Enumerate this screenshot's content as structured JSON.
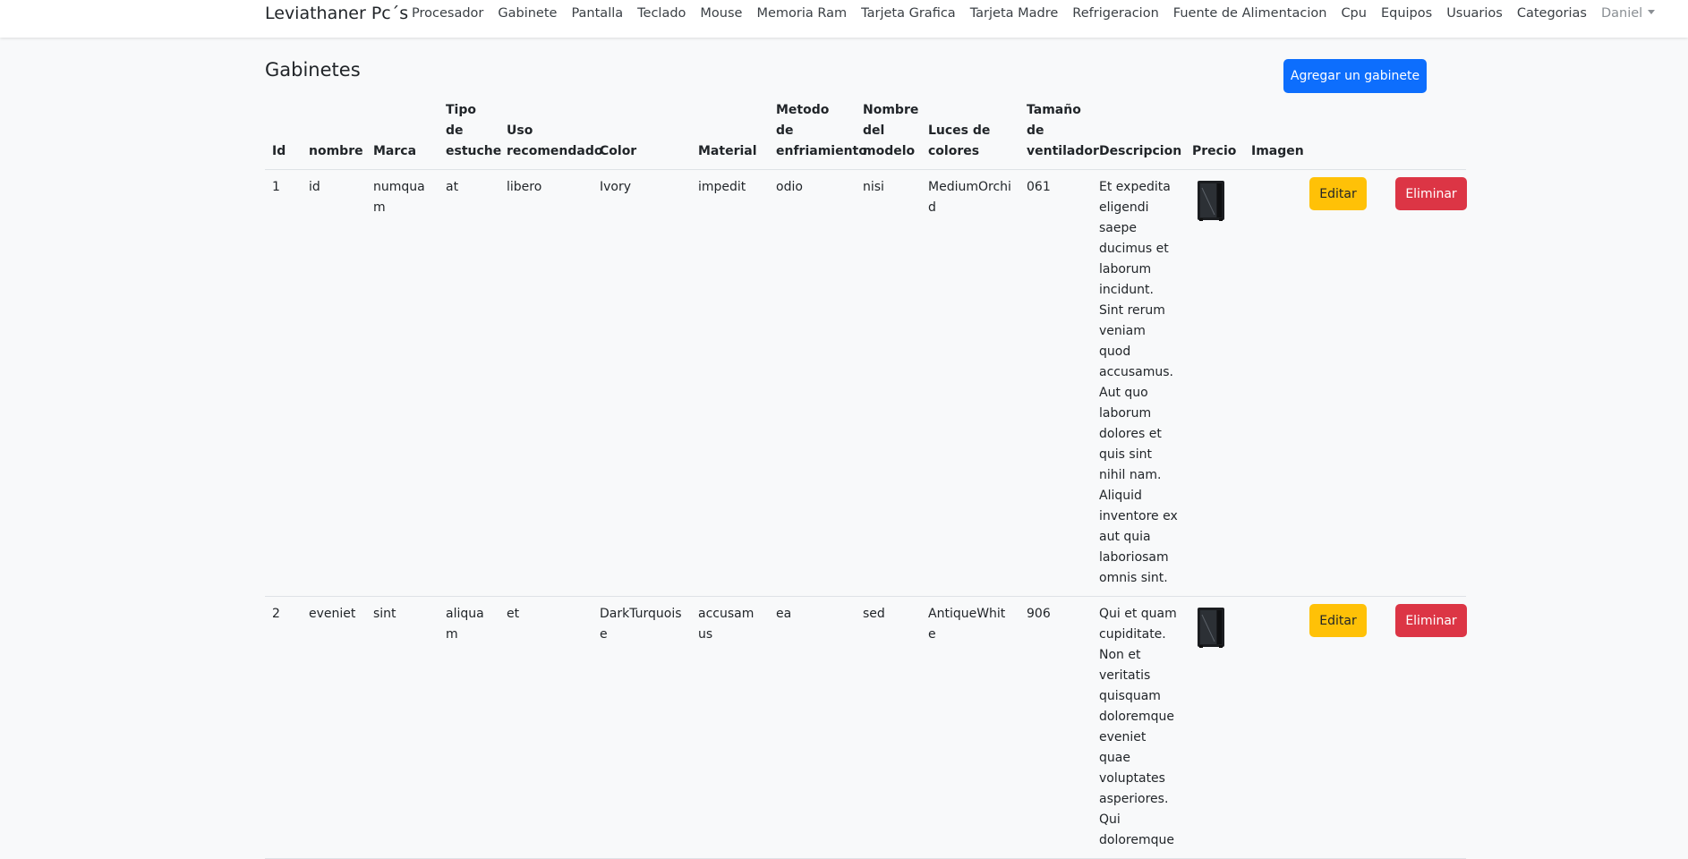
{
  "navbar": {
    "brand": "Leviathaner Pc´s",
    "links": [
      "Procesador",
      "Gabinete",
      "Pantalla",
      "Teclado",
      "Mouse",
      "Memoria Ram",
      "Tarjeta Grafica",
      "Tarjeta Madre",
      "Refrigeracion",
      "Fuente de Alimentacion",
      "Cpu",
      "Equipos",
      "Usuarios",
      "Categorias"
    ],
    "user": "Daniel"
  },
  "page": {
    "title": "Gabinetes",
    "add_button": "Agregar un gabinete"
  },
  "table": {
    "headers": [
      "Id",
      "nombre",
      "Marca",
      "Tipo de estuche",
      "Uso recomendado",
      "Color",
      "Material",
      "Metodo de enfriamiento",
      "Nombre del modelo",
      "Luces de colores",
      "Tamaño de ventilador",
      "Descripcion",
      "Precio",
      "Imagen"
    ],
    "edit_label": "Editar",
    "delete_label": "Eliminar",
    "rows": [
      {
        "id": "1",
        "nombre": "id",
        "marca": "numquam",
        "tipo": "at",
        "uso": "libero",
        "color": "Ivory",
        "material": "impedit",
        "metodo": "odio",
        "modelo": "nisi",
        "luces": "MediumOrchid",
        "ventilador": "061",
        "descripcion": "Et expedita eligendi saepe ducimus et laborum incidunt. Sint rerum veniam quod accusamus. Aut quo laborum dolores et quis sint nihil nam. Aliquid inventore ex aut quia laboriosam omnis sint.",
        "precio_icon": "pc-case-icon"
      },
      {
        "id": "2",
        "nombre": "eveniet",
        "marca": "sint",
        "tipo": "aliquam",
        "uso": "et",
        "color": "DarkTurquoise",
        "material": "accusamus",
        "metodo": "ea",
        "modelo": "sed",
        "luces": "AntiqueWhite",
        "ventilador": "906",
        "descripcion": "Qui et quam cupiditate. Non et veritatis quisquam doloremque eveniet quae voluptates asperiores. Qui doloremque",
        "precio_icon": "pc-case-icon"
      }
    ]
  }
}
